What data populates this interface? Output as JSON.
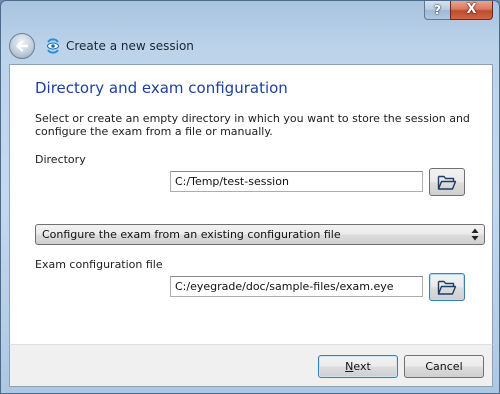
{
  "window": {
    "help_glyph": "?",
    "close_glyph": "X",
    "wizard_title": "Create a new session"
  },
  "page": {
    "heading": "Directory and exam configuration",
    "description": "Select or create an empty directory in which you want to store the session and configure the exam from a file or manually."
  },
  "directory": {
    "label": "Directory",
    "value": "C:/Temp/test-session",
    "browse_icon": "folder-open-icon"
  },
  "config_mode": {
    "selected": "Configure the exam from an existing configuration file",
    "arrow_icon": "updown-arrows-icon"
  },
  "exam_config": {
    "label": "Exam configuration file",
    "value": "C:/eyegrade/doc/sample-files/exam.eye",
    "browse_icon": "folder-open-icon"
  },
  "footer": {
    "next_mnemonic": "N",
    "next_rest": "ext",
    "cancel_label": "Cancel"
  },
  "colors": {
    "heading": "#1f3fa0",
    "close_button": "#c14a2c",
    "focus_border": "#3c7fb1"
  }
}
